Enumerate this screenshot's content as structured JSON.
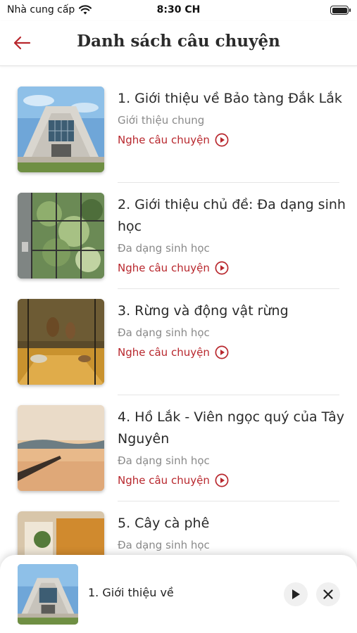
{
  "status_bar": {
    "carrier": "Nhà cung cấp",
    "time": "8:30 CH"
  },
  "header": {
    "title": "Danh sách câu chuyện"
  },
  "stories": [
    {
      "title": "1. Giới thiệu về Bảo tàng Đắk Lắk",
      "category": "Giới thiệu chung",
      "listen_label": "Nghe câu chuyện"
    },
    {
      "title": "2. Giới thiệu chủ đề: Đa dạng sinh học",
      "category": "Đa dạng sinh học",
      "listen_label": "Nghe câu chuyện"
    },
    {
      "title": "3. Rừng và động vật rừng",
      "category": "Đa dạng sinh học",
      "listen_label": "Nghe câu chuyện"
    },
    {
      "title": "4. Hồ Lắk - Viên ngọc quý của Tây Nguyên",
      "category": "Đa dạng sinh học",
      "listen_label": "Nghe câu chuyện"
    },
    {
      "title": "5. Cây cà phê",
      "category": "Đa dạng sinh học",
      "listen_label": ""
    }
  ],
  "mini_player": {
    "title": "1. Giới thiệu về"
  },
  "colors": {
    "accent": "#b8272d",
    "muted_text": "#8a8a8a"
  },
  "icons": [
    "wifi-icon",
    "battery-icon",
    "back-arrow-icon",
    "play-circle-icon",
    "play-icon",
    "close-icon"
  ]
}
